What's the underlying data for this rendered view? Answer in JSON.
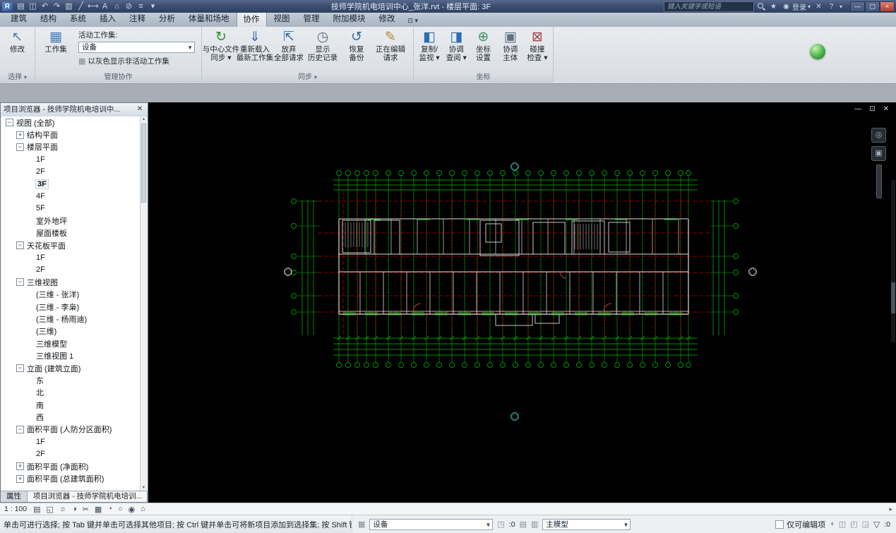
{
  "titlebar": {
    "title": "技师学院机电培训中心_张洋.rvt - 楼层平面: 3F",
    "search_placeholder": "键入关键字或短语",
    "login": "登录"
  },
  "tabs": [
    "建筑",
    "结构",
    "系统",
    "插入",
    "注释",
    "分析",
    "体量和场地",
    "协作",
    "视图",
    "管理",
    "附加模块",
    "修改"
  ],
  "active_tab": "协作",
  "icons": {
    "qat": [
      {
        "name": "open-file-icon",
        "glyph": "▤"
      },
      {
        "name": "save-icon",
        "glyph": "◫"
      },
      {
        "name": "undo-icon",
        "glyph": "↶"
      },
      {
        "name": "redo-icon",
        "glyph": "↷"
      },
      {
        "name": "print-icon",
        "glyph": "▥"
      },
      {
        "name": "measure-icon",
        "glyph": "╱"
      },
      {
        "name": "aligned-dimension-icon",
        "glyph": "⟷"
      },
      {
        "name": "text-icon",
        "glyph": "A"
      },
      {
        "name": "default-3d-view-icon",
        "glyph": "⌂"
      },
      {
        "name": "section-icon",
        "glyph": "⊘"
      },
      {
        "name": "thin-lines-icon",
        "glyph": "≡"
      },
      {
        "name": "qat-customize-icon",
        "glyph": "▾"
      }
    ],
    "viewbar": [
      {
        "name": "detail-level-icon",
        "glyph": "▤"
      },
      {
        "name": "visual-style-icon",
        "glyph": "◱"
      },
      {
        "name": "sun-path-icon",
        "glyph": "☼"
      },
      {
        "name": "shadows-icon",
        "glyph": "◑"
      },
      {
        "name": "crop-view-icon",
        "glyph": "✂"
      },
      {
        "name": "show-crop-region-icon",
        "glyph": "▦"
      },
      {
        "name": "temporary-hide-isolate-icon",
        "glyph": "◔"
      },
      {
        "name": "reveal-hidden-elements-icon",
        "glyph": "○"
      },
      {
        "name": "worksharing-display-icon",
        "glyph": "◉"
      },
      {
        "name": "temporary-view-properties-icon",
        "glyph": "⌂"
      }
    ],
    "status_right": [
      {
        "name": "chat-icon",
        "glyph": "◖"
      },
      {
        "name": "worksharing-monitor-icon",
        "glyph": "◫"
      },
      {
        "name": "select-toggle-icon",
        "glyph": "◰"
      },
      {
        "name": "press-drag-icon",
        "glyph": "◲"
      }
    ]
  },
  "ribbon": {
    "select_panel": {
      "label": "选择",
      "modify_label": "修改"
    },
    "worksets_panel": {
      "label": "管理协作",
      "worksets_button": "工作集",
      "active_workset_label": "活动工作集:",
      "active_workset_value": "设备",
      "gray_inactive_label": "以灰色显示非活动工作集"
    },
    "sync_panel": {
      "label": "同步",
      "buttons": [
        {
          "name": "synchronize-with-central-button",
          "icon_name": "sync-central-icon",
          "icon": "↻",
          "color": "#2e8f2e",
          "lines": [
            "与中心文件",
            "同步"
          ],
          "arrow": true
        },
        {
          "name": "reload-latest-button",
          "icon_name": "reload-latest-icon",
          "icon": "⇓",
          "color": "#2f6cab",
          "lines": [
            "重新载入",
            "最新工作集"
          ],
          "arrow": false
        },
        {
          "name": "relinquish-all-button",
          "icon_name": "relinquish-icon",
          "icon": "⇱",
          "color": "#2f6cab",
          "lines": [
            "放弃",
            "全部请求"
          ],
          "arrow": false
        },
        {
          "name": "show-history-button",
          "icon_name": "history-icon",
          "icon": "◷",
          "color": "#5d6f82",
          "lines": [
            "显示",
            "历史记录"
          ],
          "arrow": false
        },
        {
          "name": "restore-backup-button",
          "icon_name": "restore-backup-icon",
          "icon": "↺",
          "color": "#2f6cab",
          "lines": [
            "恢复",
            "备份"
          ],
          "arrow": false
        },
        {
          "name": "editing-requests-button",
          "icon_name": "editing-requests-icon",
          "icon": "✎",
          "color": "#b5862e",
          "lines": [
            "正在编辑",
            "请求"
          ],
          "arrow": false
        }
      ]
    },
    "coord_panel": {
      "label": "坐标",
      "buttons": [
        {
          "name": "copy-monitor-button",
          "icon_name": "copy-monitor-icon",
          "icon": "◧",
          "color": "#2f6cab",
          "lines": [
            "复制/",
            "监视"
          ],
          "arrow": true
        },
        {
          "name": "coordination-review-button",
          "icon_name": "coordination-review-icon",
          "icon": "◨",
          "color": "#2f6cab",
          "lines": [
            "协调",
            "查阅"
          ],
          "arrow": true
        },
        {
          "name": "coordination-settings-button",
          "icon_name": "coordination-settings-icon",
          "icon": "⊕",
          "color": "#3f8f5f",
          "lines": [
            "坐标",
            "设置"
          ],
          "arrow": false
        },
        {
          "name": "coordination-host-button",
          "icon_name": "coordination-host-icon",
          "icon": "▣",
          "color": "#5d6f82",
          "lines": [
            "协调",
            "主体"
          ],
          "arrow": false
        },
        {
          "name": "interference-check-button",
          "icon_name": "interference-check-icon",
          "icon": "⊠",
          "color": "#a04545",
          "lines": [
            "碰撞",
            "检查"
          ],
          "arrow": true
        }
      ]
    }
  },
  "browser": {
    "title": "项目浏览器 - 技师学院机电培训中...",
    "tree": [
      {
        "label": "视图 (全部)",
        "level": 0,
        "expand": "open"
      },
      {
        "label": "结构平面",
        "level": 1,
        "expand": "closed"
      },
      {
        "label": "楼层平面",
        "level": 1,
        "expand": "open"
      },
      {
        "label": "1F",
        "level": 2
      },
      {
        "label": "2F",
        "level": 2
      },
      {
        "label": "3F",
        "level": 2,
        "bold": true
      },
      {
        "label": "4F",
        "level": 2
      },
      {
        "label": "5F",
        "level": 2
      },
      {
        "label": "室外地坪",
        "level": 2
      },
      {
        "label": "屋面楼板",
        "level": 2
      },
      {
        "label": "天花板平面",
        "level": 1,
        "expand": "open"
      },
      {
        "label": "1F",
        "level": 2
      },
      {
        "label": "2F",
        "level": 2
      },
      {
        "label": "三维视图",
        "level": 1,
        "expand": "open"
      },
      {
        "label": "(三维 - 张洋)",
        "level": 2
      },
      {
        "label": "(三维 - 李枭)",
        "level": 2
      },
      {
        "label": "(三维 - 杨雨迪)",
        "level": 2
      },
      {
        "label": "(三维)",
        "level": 2
      },
      {
        "label": "三维模型",
        "level": 2
      },
      {
        "label": "三维视图 1",
        "level": 2
      },
      {
        "label": "立面 (建筑立面)",
        "level": 1,
        "expand": "open"
      },
      {
        "label": "东",
        "level": 2
      },
      {
        "label": "北",
        "level": 2
      },
      {
        "label": "南",
        "level": 2
      },
      {
        "label": "西",
        "level": 2
      },
      {
        "label": "面积平面 (人防分区面积)",
        "level": 1,
        "expand": "open"
      },
      {
        "label": "1F",
        "level": 2
      },
      {
        "label": "2F",
        "level": 2
      },
      {
        "label": "面积平面 (净面积)",
        "level": 1,
        "expand": "closed"
      },
      {
        "label": "面积平面 (总建筑面积)",
        "level": 1,
        "expand": "closed"
      }
    ],
    "bottom_tabs": [
      "属性",
      "项目浏览器 - 技师学院机电培训..."
    ]
  },
  "view_bar": {
    "scale": "1 : 100"
  },
  "status_bar": {
    "hint": "单击可进行选择; 按 Tab 键并单击可选择其他项目; 按 Ctrl 键并单击可将新项目添加到选择集; 按 Shift 键",
    "workset_value": "设备",
    "requests_count": ":0",
    "design_option_value": "主模型",
    "editable_only_label": "仅可编辑项",
    "filter_count": ":0"
  }
}
